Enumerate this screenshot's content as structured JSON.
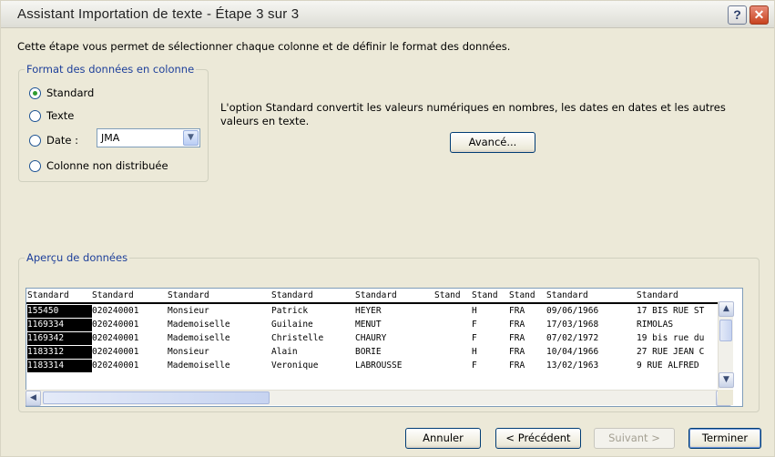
{
  "window": {
    "title": "Assistant Importation de texte - Étape 3 sur 3",
    "help_label": "?",
    "close_label": "✕"
  },
  "intro": "Cette étape vous permet de sélectionner chaque colonne et de définir le format des données.",
  "format_group": {
    "legend": "Format des données en colonne",
    "options": [
      {
        "label": "Standard",
        "checked": true
      },
      {
        "label": "Texte",
        "checked": false
      },
      {
        "label": "Date :",
        "checked": false
      },
      {
        "label": "Colonne non distribuée",
        "checked": false
      }
    ],
    "date_select": {
      "value": "JMA"
    }
  },
  "description": "L'option Standard convertit les valeurs numériques en nombres, les dates en dates et les autres valeurs en texte.",
  "advanced_label": "Avancé...",
  "preview": {
    "legend": "Aperçu de données",
    "headers": [
      "Standard",
      "Standard",
      "Standard",
      "Standard",
      "Standard",
      "Stand",
      "Stand",
      "Stand",
      "Standard",
      "Standard"
    ],
    "rows": [
      [
        "155450",
        "020240001",
        "Monsieur",
        "Patrick",
        "HEYER",
        "",
        "H",
        "FRA",
        "09/06/1966",
        "17 BIS RUE ST"
      ],
      [
        "1169334",
        "020240001",
        "Mademoiselle",
        "Guilaine",
        "MENUT",
        "",
        "F",
        "FRA",
        "17/03/1968",
        "RIMOLAS"
      ],
      [
        "1169342",
        "020240001",
        "Mademoiselle",
        "Christelle",
        "CHAURY",
        "",
        "F",
        "FRA",
        "07/02/1972",
        "19 bis rue du"
      ],
      [
        "1183312",
        "020240001",
        "Monsieur",
        "Alain",
        "BORIE",
        "",
        "H",
        "FRA",
        "10/04/1966",
        "27 RUE JEAN C"
      ],
      [
        "1183314",
        "020240001",
        "Mademoiselle",
        "Veronique",
        "LABROUSSE",
        "",
        "F",
        "FRA",
        "13/02/1963",
        "9 RUE ALFRED"
      ]
    ]
  },
  "buttons": {
    "cancel": "Annuler",
    "previous": "< Précédent",
    "next": "Suivant >",
    "finish": "Terminer"
  },
  "icons": {
    "select_arrow": "▼",
    "scroll_up": "▲",
    "scroll_down": "▼",
    "scroll_left": "◀",
    "scroll_right": "▶"
  }
}
